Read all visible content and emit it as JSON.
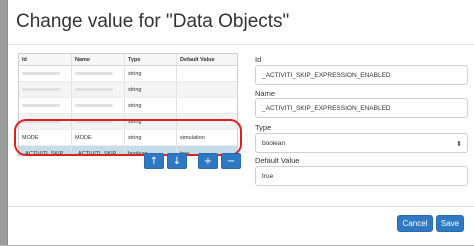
{
  "dialog": {
    "title": "Change value for \"Data Objects\"",
    "close_glyph": "×"
  },
  "grid": {
    "columns": [
      "Id",
      "Name",
      "Type",
      "Default Value"
    ],
    "rows": [
      {
        "id": "",
        "name": "",
        "type": "string",
        "default": "",
        "redacted": true
      },
      {
        "id": "",
        "name": "",
        "type": "string",
        "default": "",
        "redacted": true
      },
      {
        "id": "",
        "name": "",
        "type": "string",
        "default": "",
        "redacted": true
      },
      {
        "id": "",
        "name": "",
        "type": "string",
        "default": "",
        "redacted": true
      },
      {
        "id": "MODE",
        "name": "MODE",
        "type": "string",
        "default": "simulation"
      },
      {
        "id": "_ACTIVITI_SKIP...",
        "name": "_ACTIVITI_SKIP...",
        "type": "boolean",
        "default": "true",
        "selected": true
      }
    ]
  },
  "toolbar": {
    "move_up": "↑",
    "move_down": "↓",
    "add": "+",
    "remove": "−"
  },
  "form": {
    "id_label": "Id",
    "id_value": "_ACTIVITI_SKIP_EXPRESSION_ENABLED",
    "name_label": "Name",
    "name_value": "_ACTIVITI_SKIP_EXPRESSION_ENABLED",
    "type_label": "Type",
    "type_value": "boolean",
    "default_label": "Default Value",
    "default_value": "true"
  },
  "footer": {
    "cancel_label": "Cancel",
    "save_label": "Save"
  },
  "colors": {
    "primary": "#2f79c4",
    "selected_row": "#c5dde9",
    "annotation": "#e02020"
  }
}
